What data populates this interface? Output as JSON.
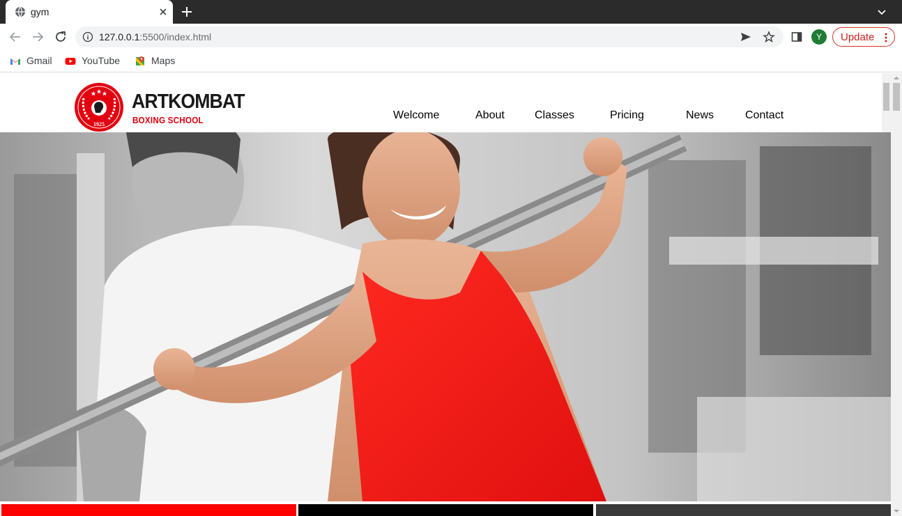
{
  "browser": {
    "tab": {
      "title": "gym",
      "icon": "globe-icon"
    },
    "url": {
      "host": "127.0.0.1",
      "rest": ":5500/index.html"
    },
    "profile_initial": "Y",
    "update_label": "Update",
    "bookmarks": [
      {
        "label": "Gmail",
        "icon": "gmail-icon"
      },
      {
        "label": "YouTube",
        "icon": "youtube-icon"
      },
      {
        "label": "Maps",
        "icon": "maps-icon"
      }
    ]
  },
  "site": {
    "logo": {
      "title": "ARTKOMBAT",
      "subtitle": "BOXING SCHOOL",
      "year": "1925"
    },
    "nav": [
      {
        "label": "Welcome"
      },
      {
        "label": "About"
      },
      {
        "label": "Classes"
      },
      {
        "label": "Pricing"
      },
      {
        "label": "News"
      },
      {
        "label": "Contact"
      }
    ],
    "hero_alt": "Trainer spotting a smiling woman lifting a barbell in a gym",
    "strip_colors": [
      "#ff0000",
      "#000000",
      "#3a3a3a"
    ]
  },
  "colors": {
    "brand_red": "#e3000f",
    "update_red": "#c5221f",
    "avatar_green": "#1e7c34"
  }
}
